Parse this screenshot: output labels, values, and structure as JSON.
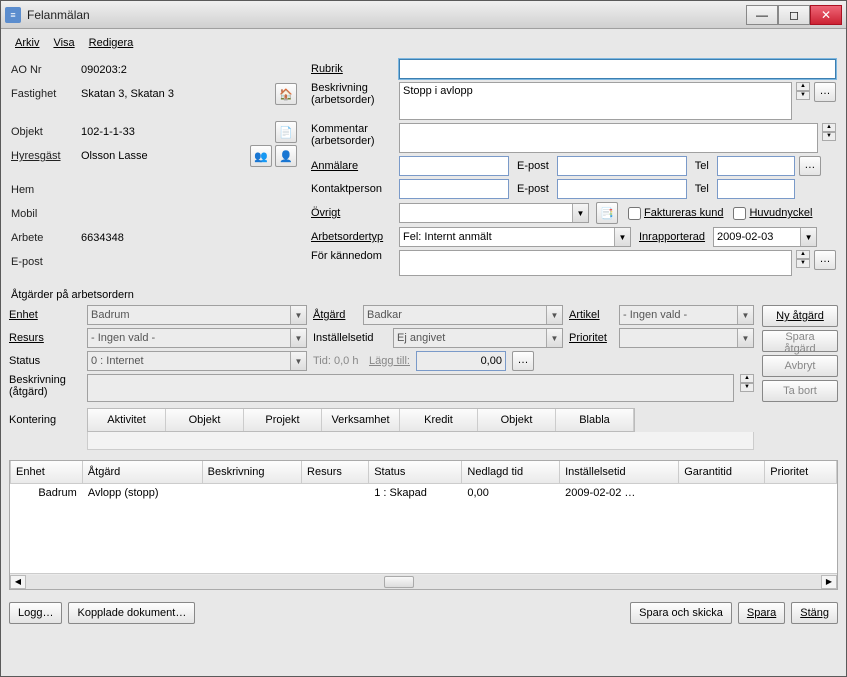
{
  "window": {
    "title": "Felanmälan"
  },
  "menu": {
    "arkiv": "Arkiv",
    "visa": "Visa",
    "redigera": "Redigera"
  },
  "left": {
    "ao_nr_lbl": "AO Nr",
    "ao_nr": "090203:2",
    "fastighet_lbl": "Fastighet",
    "fastighet": "Skatan 3, Skatan 3",
    "objekt_lbl": "Objekt",
    "objekt": "102-1-1-33",
    "hyresgast_lbl": "Hyresgäst",
    "hyresgast": "Olsson Lasse",
    "hem_lbl": "Hem",
    "mobil_lbl": "Mobil",
    "arbete_lbl": "Arbete",
    "arbete": "6634348",
    "epost_lbl": "E-post"
  },
  "right": {
    "rubrik_lbl": "Rubrik",
    "rubrik": "",
    "beskrivning_lbl1": "Beskrivning",
    "beskrivning_lbl2": "(arbetsorder)",
    "beskrivning": "Stopp i avlopp",
    "kommentar_lbl1": "Kommentar",
    "kommentar_lbl2": "(arbetsorder)",
    "kommentar": "",
    "anmalare_lbl": "Anmälare",
    "epost_lbl": "E-post",
    "tel_lbl": "Tel",
    "kontaktperson_lbl": "Kontaktperson",
    "ovrigt_lbl": "Övrigt",
    "ovrigt": "",
    "fakt_kund_lbl": "Faktureras kund",
    "huvudnyckel_lbl": "Huvudnyckel",
    "arbetsordertyp_lbl": "Arbetsordertyp",
    "arbetsordertyp": "Fel: Internt anmält",
    "inrapporterad_lbl": "Inrapporterad",
    "inrapporterad": "2009-02-03",
    "kannedom_lbl": "För kännedom",
    "kannedom": ""
  },
  "atgarder_section": "Åtgärder på arbetsordern",
  "ag": {
    "enhet_lbl": "Enhet",
    "enhet": "Badrum",
    "atgard_lbl": "Åtgärd",
    "atgard": "Badkar",
    "artikel_lbl": "Artikel",
    "artikel": "- Ingen vald -",
    "resurs_lbl": "Resurs",
    "resurs": "- Ingen vald -",
    "installelsetid_lbl": "Inställelsetid",
    "installelsetid": "Ej angivet",
    "prioritet_lbl": "Prioritet",
    "prioritet": "",
    "status_lbl": "Status",
    "status": "0 : Internet",
    "tid_lbl": "Tid: 0,0 h",
    "lagg_till_lbl": "Lägg till:",
    "lagg_till": "0,00",
    "beskrivning_lbl1": "Beskrivning",
    "beskrivning_lbl2": "(åtgärd)",
    "beskrivning": "",
    "kontering_lbl": "Kontering"
  },
  "buttons": {
    "ny_atgard": "Ny åtgärd",
    "spara_atgard": "Spara åtgärd",
    "avbryt": "Avbryt",
    "ta_bort": "Ta bort",
    "logg": "Logg…",
    "kopplade_dok": "Kopplade dokument…",
    "spara_skicka": "Spara och skicka",
    "spara": "Spara",
    "stang": "Stäng"
  },
  "kontering_tabs": [
    "Aktivitet",
    "Objekt",
    "Projekt",
    "Verksamhet",
    "Kredit",
    "Objekt",
    "Blabla"
  ],
  "table": {
    "headers": [
      "Enhet",
      "Åtgärd",
      "Beskrivning",
      "Resurs",
      "Status",
      "Nedlagd tid",
      "Inställelsetid",
      "Garantitid",
      "Prioritet"
    ],
    "rows": [
      {
        "enhet": "Badrum",
        "atgard": "Avlopp (stopp)",
        "beskrivning": "",
        "resurs": "",
        "status": "1 : Skapad",
        "nedlagd": "0,00",
        "installelsetid": "2009-02-02 …",
        "garantitid": "",
        "prioritet": ""
      }
    ]
  }
}
